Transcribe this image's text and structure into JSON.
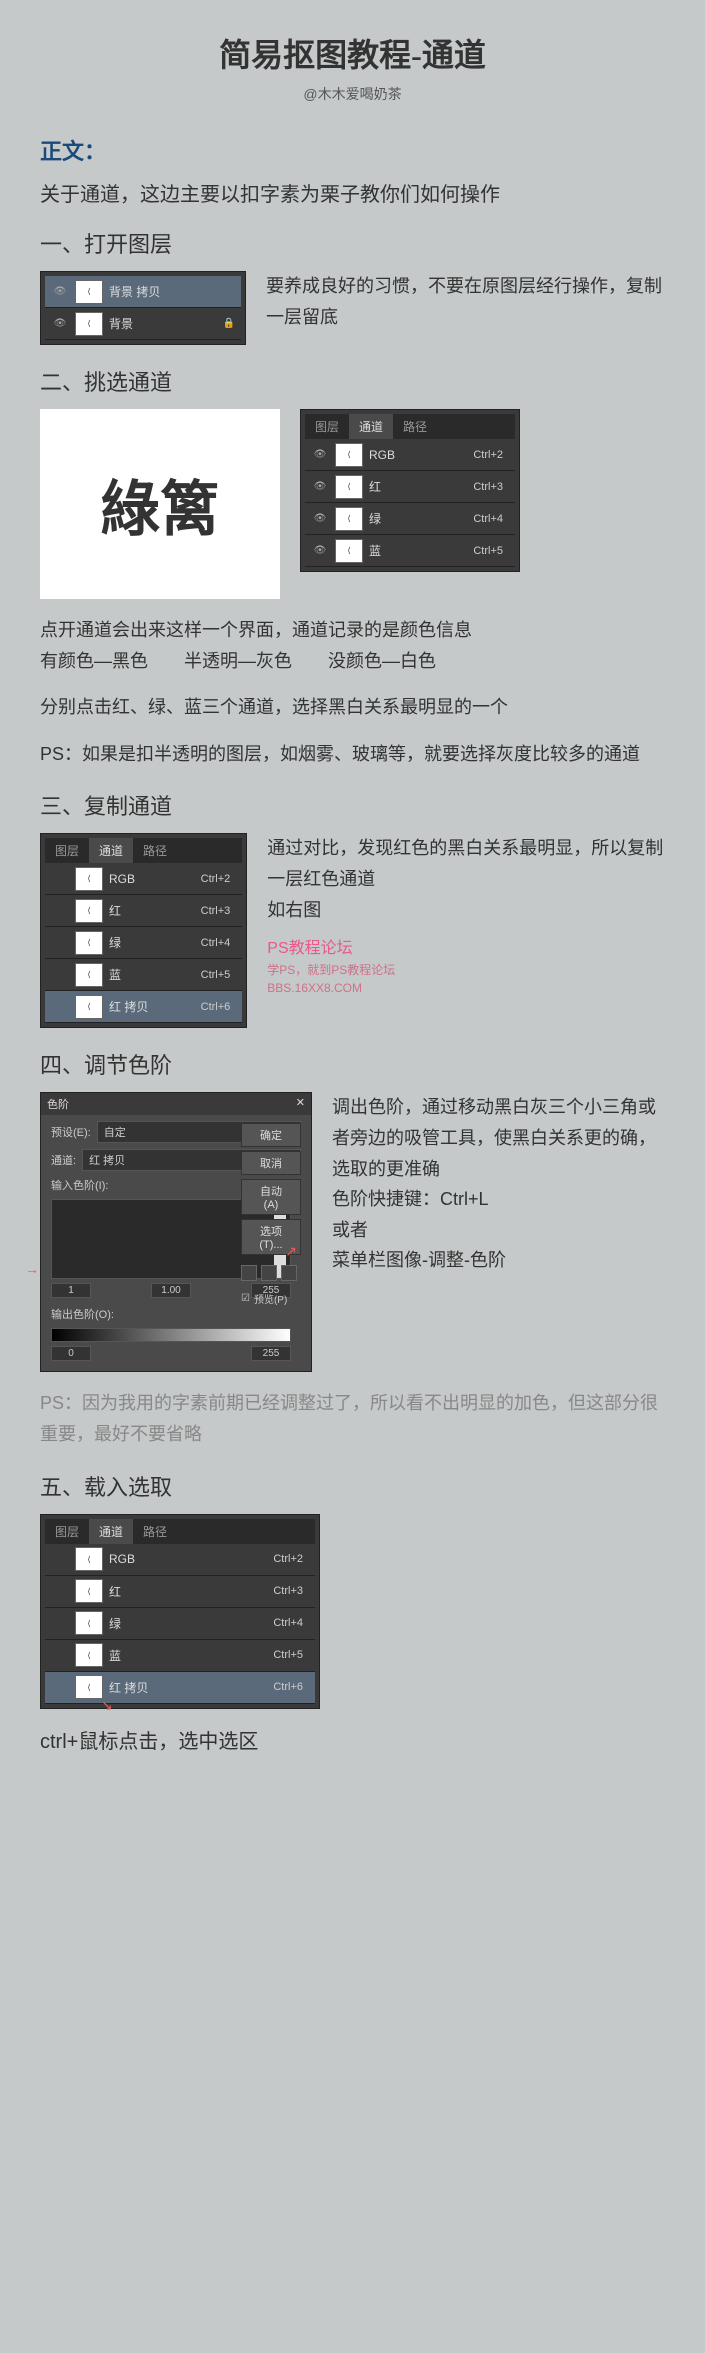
{
  "title": "简易抠图教程-通道",
  "author": "@木木爱喝奶茶",
  "sectionLabel": "正文：",
  "intro": "关于通道，这边主要以扣字素为栗子教你们如何操作",
  "step1": {
    "title": "一、打开图层",
    "layers": [
      {
        "name": "背景 拷贝",
        "selected": true
      },
      {
        "name": "背景",
        "selected": false,
        "locked": true
      }
    ],
    "desc": "要养成良好的习惯，不要在原图层经行操作，复制一层留底"
  },
  "step2": {
    "title": "二、挑选通道",
    "tabs": [
      "图层",
      "通道",
      "路径"
    ],
    "channels": [
      {
        "name": "RGB",
        "shortcut": "Ctrl+2"
      },
      {
        "name": "红",
        "shortcut": "Ctrl+3"
      },
      {
        "name": "绿",
        "shortcut": "Ctrl+4"
      },
      {
        "name": "蓝",
        "shortcut": "Ctrl+5"
      }
    ],
    "calligraphy": "綠篱",
    "desc1": "点开通道会出来这样一个界面，通道记录的是颜色信息",
    "desc2": "有颜色—黑色　　半透明—灰色　　没颜色—白色",
    "desc3": "分别点击红、绿、蓝三个通道，选择黑白关系最明显的一个",
    "desc4": "PS：如果是扣半透明的图层，如烟雾、玻璃等，就要选择灰度比较多的通道"
  },
  "step3": {
    "title": "三、复制通道",
    "tabs": [
      "图层",
      "通道",
      "路径"
    ],
    "channels": [
      {
        "name": "RGB",
        "shortcut": "Ctrl+2"
      },
      {
        "name": "红",
        "shortcut": "Ctrl+3"
      },
      {
        "name": "绿",
        "shortcut": "Ctrl+4"
      },
      {
        "name": "蓝",
        "shortcut": "Ctrl+5"
      },
      {
        "name": "红 拷贝",
        "shortcut": "Ctrl+6",
        "selected": true
      }
    ],
    "desc": "通过对比，发现红色的黑白关系最明显，所以复制一层红色通道\n如右图",
    "watermark1": "PS教程论坛",
    "watermark2": "学PS，就到PS教程论坛",
    "watermark3": "BBS.16XX8.COM"
  },
  "step4": {
    "title": "四、调节色阶",
    "dialogTitle": "色阶",
    "presetLabel": "预设(E):",
    "presetValue": "自定",
    "channelLabel": "通道:",
    "channelValue": "红 拷贝",
    "inputLabel": "输入色阶(I):",
    "outputLabel": "输出色阶(O):",
    "inputValues": [
      "1",
      "1.00",
      "255"
    ],
    "outputValues": [
      "0",
      "255"
    ],
    "buttons": {
      "ok": "确定",
      "cancel": "取消",
      "auto": "自动(A)",
      "options": "选项(T)..."
    },
    "previewLabel": "预览(P)",
    "desc": "调出色阶，通过移动黑白灰三个小三角或者旁边的吸管工具，使黑白关系更的确，选取的更准确",
    "shortcut": "色阶快捷键：Ctrl+L",
    "or": "或者",
    "menu": "菜单栏图像-调整-色阶",
    "tip": "PS：因为我用的字素前期已经调整过了，所以看不出明显的加色，但这部分很重要，最好不要省略"
  },
  "step5": {
    "title": "五、载入选取",
    "tabs": [
      "图层",
      "通道",
      "路径"
    ],
    "channels": [
      {
        "name": "RGB",
        "shortcut": "Ctrl+2"
      },
      {
        "name": "红",
        "shortcut": "Ctrl+3"
      },
      {
        "name": "绿",
        "shortcut": "Ctrl+4"
      },
      {
        "name": "蓝",
        "shortcut": "Ctrl+5"
      },
      {
        "name": "红 拷贝",
        "shortcut": "Ctrl+6",
        "selected": true
      }
    ],
    "note": "ctrl+鼠标点击，选中选区"
  }
}
